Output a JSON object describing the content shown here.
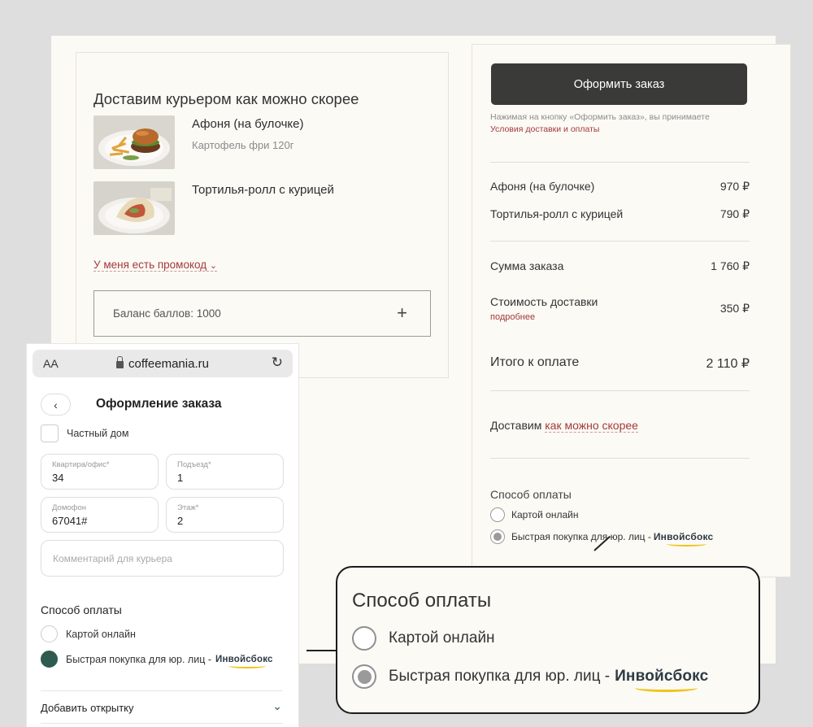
{
  "desktop": {
    "left": {
      "title": "Доставим курьером как можно скорее",
      "items": [
        {
          "name": "Афоня (на булочке)",
          "sub": "Картофель фри 120г"
        },
        {
          "name": "Тортилья-ролл с курицей",
          "sub": ""
        }
      ],
      "promo": "У меня есть промокод",
      "promo_chevron": "⌄",
      "balance": "Баланс баллов: 1000",
      "balance_plus": "+"
    },
    "right": {
      "order_button": "Оформить заказ",
      "disclaimer": "Нажимая на кнопку «Оформить заказ», вы принимаете",
      "terms_link": "Условия доставки и оплаты",
      "lines": [
        {
          "label": "Афоня (на булочке)",
          "price": "970 ₽"
        },
        {
          "label": "Тортилья-ролл с курицей",
          "price": "790 ₽"
        }
      ],
      "subtotal": {
        "label": "Сумма заказа",
        "price": "1 760 ₽"
      },
      "delivery": {
        "label": "Стоимость доставки",
        "price": "350 ₽",
        "more": "подробнее"
      },
      "total": {
        "label": "Итого к оплате",
        "price": "2 110 ₽"
      },
      "deliver_prefix": "Доставим",
      "deliver_link": "как можно скорее",
      "payment_title": "Способ оплаты",
      "payment_options": [
        "Картой онлайн",
        "Быстрая покупка для юр. лиц -"
      ],
      "invoicebox": "Инвойсбокс",
      "selected_payment_index": 1
    }
  },
  "phone": {
    "aa": "AA",
    "url": "coffeemania.ru",
    "reload": "↻",
    "back": "‹",
    "title": "Оформление заказа",
    "private_house": "Частный дом",
    "fields": {
      "apartment": {
        "label": "Квартира/офис*",
        "value": "34"
      },
      "entrance": {
        "label": "Подъезд*",
        "value": "1"
      },
      "intercom": {
        "label": "Домофон",
        "value": "67041#"
      },
      "floor": {
        "label": "Этаж*",
        "value": "2"
      },
      "comment_placeholder": "Комментарий для курьера"
    },
    "payment_title": "Способ оплаты",
    "payment_options": [
      "Картой онлайн",
      "Быстрая покупка для юр. лиц -"
    ],
    "invoicebox": "Инвойсбокс",
    "selected_payment_index": 1,
    "add_card": "Добавить открытку",
    "add_card_chevron": "⌄"
  },
  "callout": {
    "title": "Способ оплаты",
    "options": [
      "Картой онлайн",
      "Быстрая покупка для юр. лиц -"
    ],
    "invoicebox": "Инвойсбокс",
    "selected_index": 1
  },
  "colors": {
    "accent_red": "#a33a3a",
    "button_dark": "#3a3a38",
    "phone_radio_selected": "#2e5a50",
    "invoicebox_arc": "#f0c419"
  }
}
